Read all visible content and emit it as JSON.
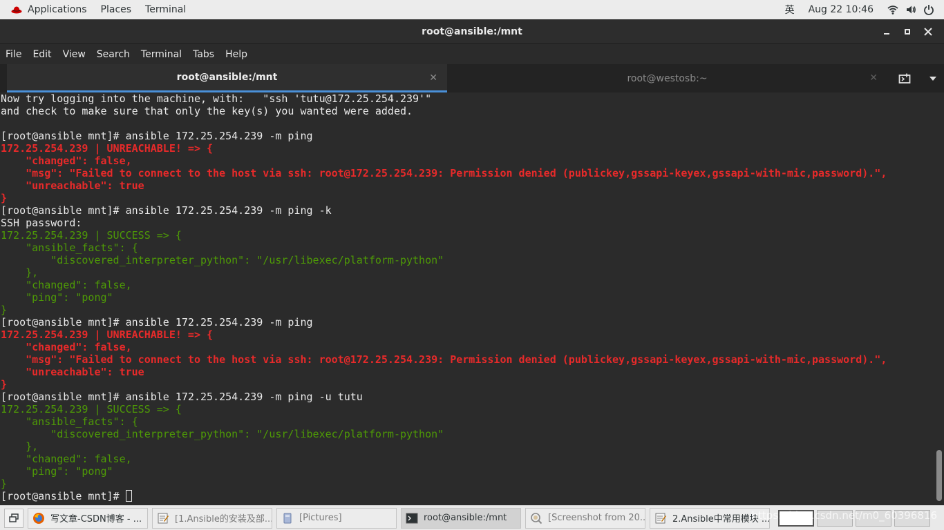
{
  "top_panel": {
    "applications": "Applications",
    "places": "Places",
    "terminal": "Terminal",
    "ime": "英",
    "clock": "Aug 22  10:46"
  },
  "window": {
    "title": "root@ansible:/mnt"
  },
  "menu": [
    "File",
    "Edit",
    "View",
    "Search",
    "Terminal",
    "Tabs",
    "Help"
  ],
  "tabs": [
    {
      "label": "root@ansible:/mnt",
      "active": true
    },
    {
      "label": "root@westosb:~",
      "active": false
    }
  ],
  "terminal_lines": [
    {
      "text": "Now try logging into the machine, with:   \"ssh 'tutu@172.25.254.239'\"",
      "style": "plain"
    },
    {
      "text": "and check to make sure that only the key(s) you wanted were added.",
      "style": "plain"
    },
    {
      "text": "",
      "style": "plain"
    },
    {
      "text": "[root@ansible mnt]# ansible 172.25.254.239 -m ping",
      "style": "plain"
    },
    {
      "text": "172.25.254.239 | UNREACHABLE! => {",
      "style": "red"
    },
    {
      "text": "    \"changed\": false,",
      "style": "red"
    },
    {
      "text": "    \"msg\": \"Failed to connect to the host via ssh: root@172.25.254.239: Permission denied (publickey,gssapi-keyex,gssapi-with-mic,password).\",",
      "style": "red"
    },
    {
      "text": "    \"unreachable\": true",
      "style": "red"
    },
    {
      "text": "}",
      "style": "red"
    },
    {
      "text": "[root@ansible mnt]# ansible 172.25.254.239 -m ping -k",
      "style": "plain"
    },
    {
      "text": "SSH password:",
      "style": "plain"
    },
    {
      "text": "172.25.254.239 | SUCCESS => {",
      "style": "green"
    },
    {
      "text": "    \"ansible_facts\": {",
      "style": "green"
    },
    {
      "text": "        \"discovered_interpreter_python\": \"/usr/libexec/platform-python\"",
      "style": "green"
    },
    {
      "text": "    },",
      "style": "green"
    },
    {
      "text": "    \"changed\": false,",
      "style": "green"
    },
    {
      "text": "    \"ping\": \"pong\"",
      "style": "green"
    },
    {
      "text": "}",
      "style": "green"
    },
    {
      "text": "[root@ansible mnt]# ansible 172.25.254.239 -m ping",
      "style": "plain"
    },
    {
      "text": "172.25.254.239 | UNREACHABLE! => {",
      "style": "red"
    },
    {
      "text": "    \"changed\": false,",
      "style": "red"
    },
    {
      "text": "    \"msg\": \"Failed to connect to the host via ssh: root@172.25.254.239: Permission denied (publickey,gssapi-keyex,gssapi-with-mic,password).\",",
      "style": "red"
    },
    {
      "text": "    \"unreachable\": true",
      "style": "red"
    },
    {
      "text": "}",
      "style": "red"
    },
    {
      "text": "[root@ansible mnt]# ansible 172.25.254.239 -m ping -u tutu",
      "style": "plain"
    },
    {
      "text": "172.25.254.239 | SUCCESS => {",
      "style": "green"
    },
    {
      "text": "    \"ansible_facts\": {",
      "style": "green"
    },
    {
      "text": "        \"discovered_interpreter_python\": \"/usr/libexec/platform-python\"",
      "style": "green"
    },
    {
      "text": "    },",
      "style": "green"
    },
    {
      "text": "    \"changed\": false,",
      "style": "green"
    },
    {
      "text": "    \"ping\": \"pong\"",
      "style": "green"
    },
    {
      "text": "}",
      "style": "green"
    },
    {
      "text": "[root@ansible mnt]# ",
      "style": "prompt"
    }
  ],
  "taskbar": {
    "items": [
      {
        "label": "写文章-CSDN博客 - ...",
        "icon": "firefox-icon",
        "state": "normal"
      },
      {
        "label": "[1.Ansible的安装及部...",
        "icon": "text-editor-icon",
        "state": "dim"
      },
      {
        "label": "[Pictures]",
        "icon": "folder-icon",
        "state": "dim"
      },
      {
        "label": "root@ansible:/mnt",
        "icon": "terminal-icon",
        "state": "active"
      },
      {
        "label": "[Screenshot from 20...",
        "icon": "image-viewer-icon",
        "state": "dim"
      },
      {
        "label": "2.Ansible中常用模块 ...",
        "icon": "text-editor-icon",
        "state": "normal"
      }
    ],
    "watermark": "https://blog.csdn.net/m0_60396816"
  },
  "colors": {
    "error_red": "#e72a2a",
    "success_green": "#4e9a06",
    "tab_accent": "#4a90d9",
    "terminal_bg": "#2b2b2b"
  }
}
